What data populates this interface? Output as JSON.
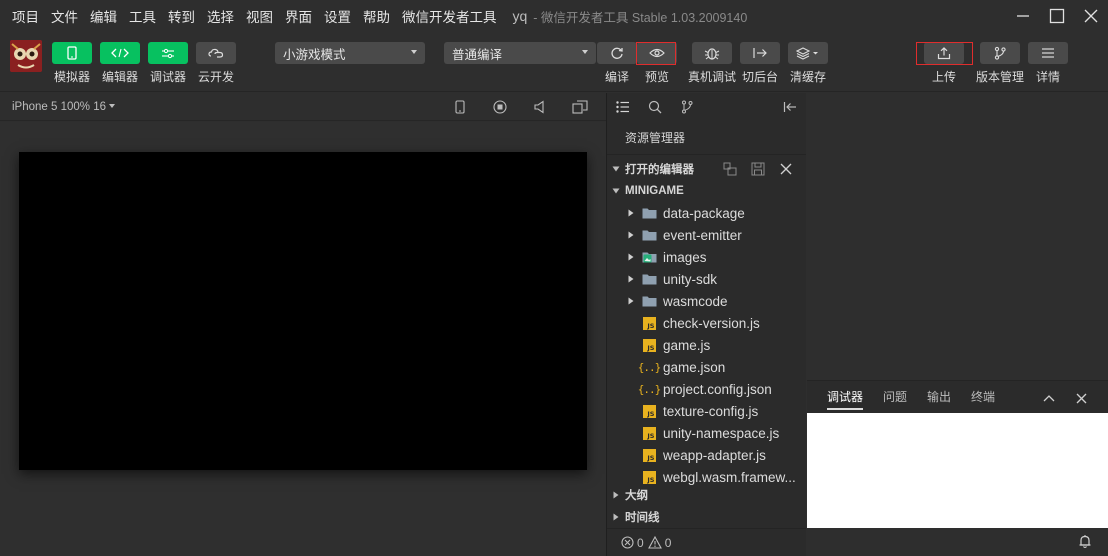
{
  "menu": [
    "项目",
    "文件",
    "编辑",
    "工具",
    "转到",
    "选择",
    "视图",
    "界面",
    "设置",
    "帮助",
    "微信开发者工具"
  ],
  "window": {
    "project": "yq",
    "subtitle": "- 微信开发者工具 Stable 1.03.2009140"
  },
  "toolbar": {
    "simulator_label": "模拟器",
    "editor_label": "编辑器",
    "debugger_label": "调试器",
    "cloud_label": "云开发",
    "mode_select": "小游戏模式",
    "compile_select": "普通编译",
    "compile_label": "编译",
    "preview_label": "预览",
    "remote_debug_label": "真机调试",
    "background_label": "切后台",
    "clear_cache_label": "清缓存",
    "upload_label": "上传",
    "version_label": "版本管理",
    "details_label": "详情"
  },
  "simulator": {
    "device": "iPhone 5 100% 16"
  },
  "explorer": {
    "title": "资源管理器",
    "open_editors": "打开的编辑器",
    "project_root": "MINIGAME",
    "items": [
      {
        "name": "data-package",
        "type": "folder"
      },
      {
        "name": "event-emitter",
        "type": "folder"
      },
      {
        "name": "images",
        "type": "image-folder"
      },
      {
        "name": "unity-sdk",
        "type": "folder"
      },
      {
        "name": "wasmcode",
        "type": "folder"
      },
      {
        "name": "check-version.js",
        "type": "js"
      },
      {
        "name": "game.js",
        "type": "js"
      },
      {
        "name": "game.json",
        "type": "json"
      },
      {
        "name": "project.config.json",
        "type": "json"
      },
      {
        "name": "texture-config.js",
        "type": "js"
      },
      {
        "name": "unity-namespace.js",
        "type": "js"
      },
      {
        "name": "weapp-adapter.js",
        "type": "js"
      },
      {
        "name": "webgl.wasm.framew...",
        "type": "js"
      }
    ],
    "outline": "大纲",
    "timeline": "时间线",
    "errors": "0",
    "warnings": "0"
  },
  "debug_panel": {
    "tabs": [
      "调试器",
      "问题",
      "输出",
      "终端"
    ],
    "active_tab": 0
  },
  "colors": {
    "accent_green": "#07c160",
    "highlight_red": "#e02d2d",
    "js_yellow": "#e8b21f"
  }
}
